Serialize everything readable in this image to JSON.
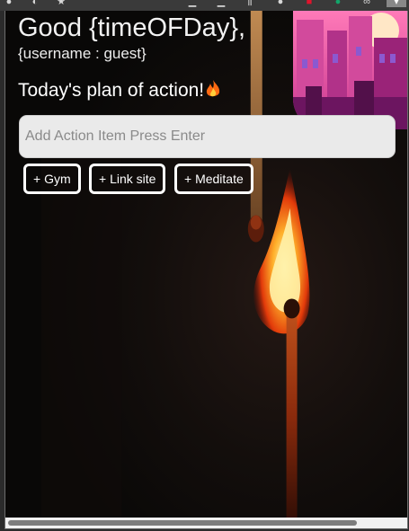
{
  "browser_toolbar": {
    "icons": [
      "back-icon",
      "reload-icon",
      "bookmark-star-icon",
      "extension-icon",
      "download-icon",
      "library-icon",
      "profile-icon",
      "red-extension-icon",
      "green-extension-icon",
      "infinity-icon",
      "puzzle-icon"
    ]
  },
  "header": {
    "greeting": "Good {timeOFDay},",
    "username": "{username : guest}"
  },
  "plan": {
    "title": "Today's plan of action!"
  },
  "action_input": {
    "placeholder": "Add Action Item Press Enter",
    "value": ""
  },
  "quick_actions": [
    {
      "label": "+ Gym"
    },
    {
      "label": "+ Link site"
    },
    {
      "label": "+ Meditate"
    }
  ],
  "scrollbar": {
    "horizontal_visible_fraction": 0.88
  },
  "colors": {
    "background": "#0d0b0a",
    "text": "#ffffff",
    "input_bg": "#eaeaea",
    "art_sky": "#ff5fa8",
    "art_building": "#7a1f6e"
  }
}
